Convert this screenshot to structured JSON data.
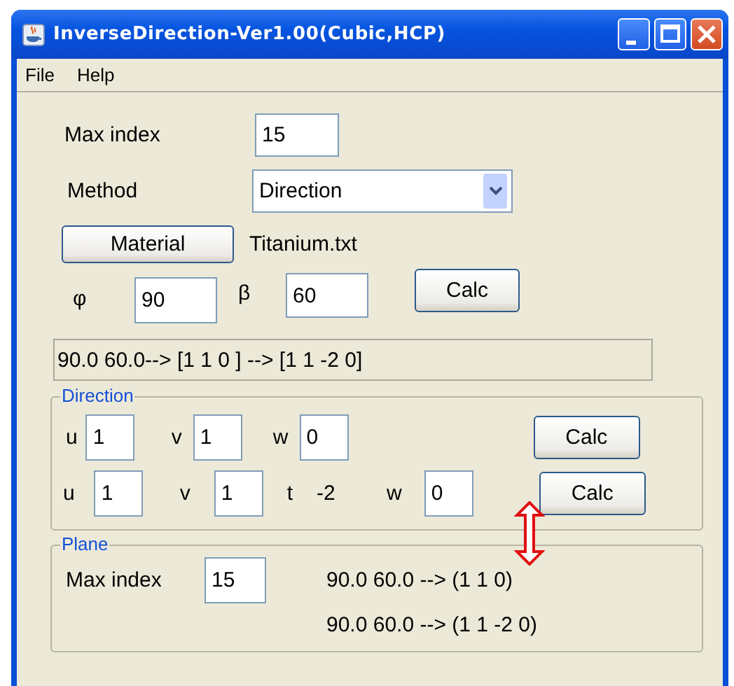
{
  "window": {
    "title": "InverseDirection-Ver1.00(Cubic,HCP)"
  },
  "menu": [
    "File",
    "Help"
  ],
  "max_index": {
    "label": "Max index",
    "value": "15"
  },
  "method": {
    "label": "Method",
    "value": "Direction"
  },
  "material": {
    "button": "Material",
    "file": "Titanium.txt"
  },
  "angles": [
    {
      "label": "φ",
      "value": "90"
    },
    {
      "label": "β",
      "value": "60"
    }
  ],
  "angle_calc_button": "Calc",
  "result": "90.0 60.0--> [1 1 0 ] --> [1 1 -2 0]",
  "direction": {
    "title": "Direction",
    "rows": [
      {
        "fields": [
          {
            "kind": "input",
            "label": "u",
            "value": "1"
          },
          {
            "kind": "input",
            "label": "v",
            "value": "1"
          },
          {
            "kind": "input",
            "label": "w",
            "value": "0"
          }
        ],
        "button": "Calc"
      },
      {
        "fields": [
          {
            "kind": "input",
            "label": "u",
            "value": "1"
          },
          {
            "kind": "input",
            "label": "v",
            "value": "1"
          },
          {
            "kind": "text",
            "label": "t",
            "value": "-2"
          },
          {
            "kind": "input",
            "label": "w",
            "value": "0"
          }
        ],
        "button": "Calc"
      }
    ]
  },
  "plane": {
    "title": "Plane",
    "label": "Max index",
    "value": "15",
    "results": [
      "90.0 60.0 --> (1 1 0)",
      "90.0 60.0 --> (1 1 -2 0)"
    ]
  }
}
